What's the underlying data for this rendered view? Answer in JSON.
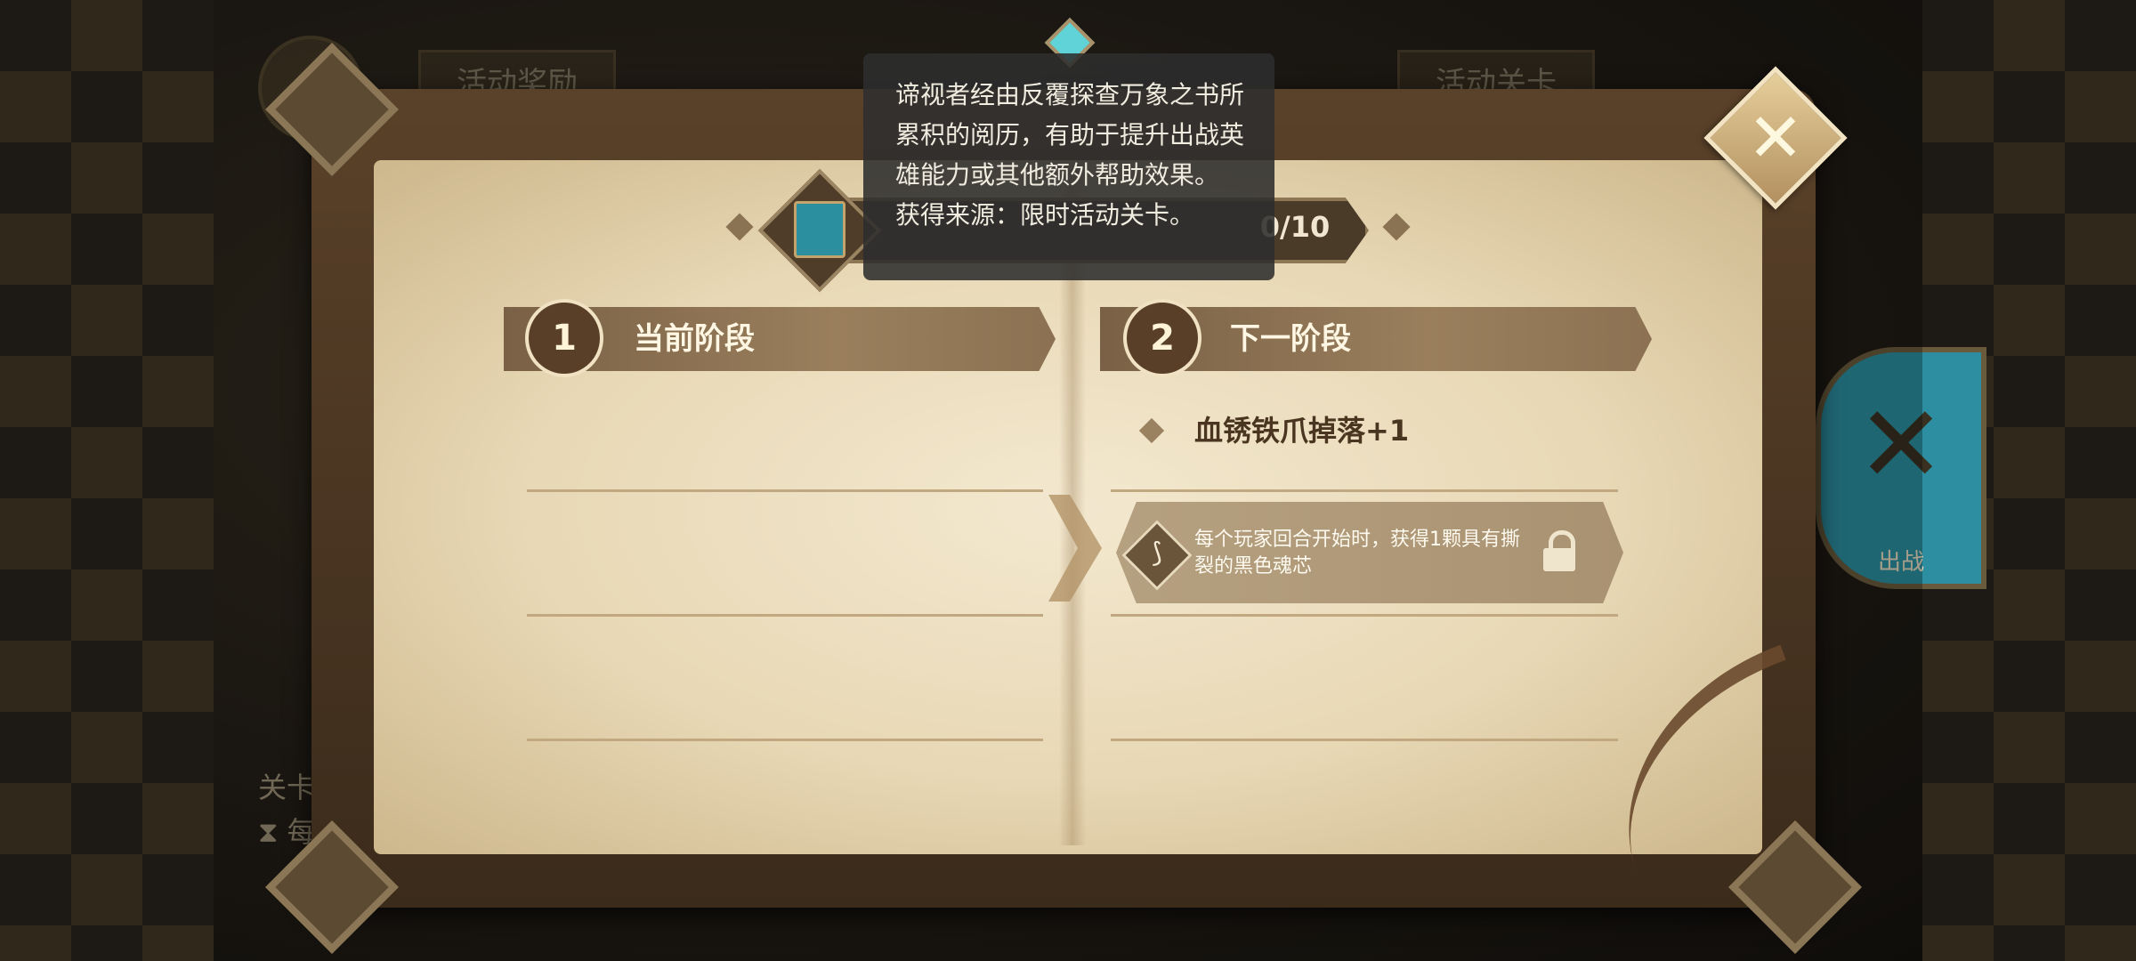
{
  "background": {
    "tab_left": "活动奖励",
    "tab_right": "活动关卡",
    "battle_label": "出战",
    "stage_prefix": "关卡",
    "timer_prefix": "每"
  },
  "tooltip": {
    "description": "谛视者经由反覆探查万象之书所累积的阅历，有助于提升出战英雄能力或其他额外帮助效果。",
    "source": "获得来源：限时活动关卡。"
  },
  "progress": {
    "text": "0/10",
    "current": 0,
    "max": 10
  },
  "current_stage": {
    "number": "1",
    "title": "当前阶段"
  },
  "next_stage": {
    "number": "2",
    "title": "下一阶段",
    "reward": "血锈铁爪掉落+1",
    "effect": "每个玩家回合开始时，获得1颗具有撕裂的黑色魂芯",
    "effect_locked": true
  },
  "icons": {
    "close": "close-icon",
    "lock": "lock-icon",
    "book": "book-icon",
    "effect": "soul-core-icon"
  },
  "colors": {
    "paper": "#e8d8b5",
    "header_bar": "#8c7252",
    "tooltip_bg": "#2d2d2d",
    "accent_gold": "#c9a86c"
  }
}
